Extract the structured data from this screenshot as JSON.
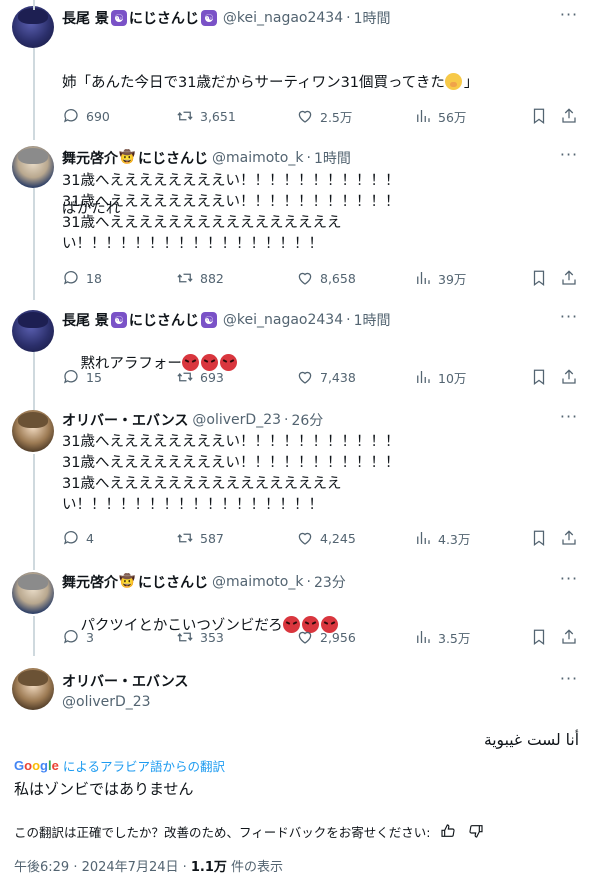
{
  "tweets": [
    {
      "name": "長尾 景",
      "badge_text": "にじさんじ",
      "handle": "@kei_nagao2434",
      "time": "1時間",
      "lines": [
        "姉「あんた今日で31歳だからサーティワン31個買ってきた",
        "」",
        "",
        "ばかたれ"
      ],
      "reply": "690",
      "retweet": "3,651",
      "like": "2.5万",
      "views": "56万"
    },
    {
      "name": "舞元啓介",
      "badge_text": "にじさんじ",
      "handle": "@maimoto_k",
      "time": "1時間",
      "text": "31歳へええええええええい！！！！！！！！！！！\n31歳へええええええええい！！！！！！！！！！！\n31歳へええええええええええええええええ\nい！！！！！！！！！！！！！！！！！",
      "reply": "18",
      "retweet": "882",
      "like": "8,658",
      "views": "39万"
    },
    {
      "name": "長尾 景",
      "badge_text": "にじさんじ",
      "handle": "@kei_nagao2434",
      "time": "1時間",
      "text": "黙れアラフォー",
      "reply": "15",
      "retweet": "693",
      "like": "7,438",
      "views": "10万"
    },
    {
      "name": "オリバー・エバンス",
      "handle": "@oliverD_23",
      "time": "26分",
      "text": "31歳へええええええええい！！！！！！！！！！！\n31歳へええええええええい！！！！！！！！！！！\n31歳へええええええええええええええええ\nい！！！！！！！！！！！！！！！！！",
      "reply": "4",
      "retweet": "587",
      "like": "4,245",
      "views": "4.3万"
    },
    {
      "name": "舞元啓介",
      "badge_text": "にじさんじ",
      "handle": "@maimoto_k",
      "time": "23分",
      "text": "パクツイとかこいつゾンビだろ",
      "reply": "3",
      "retweet": "353",
      "like": "2,956",
      "views": "3.5万"
    }
  ],
  "main": {
    "name": "オリバー・エバンス",
    "handle": "@oliverD_23",
    "original_text": "أنا لست غيبوية",
    "translated_by": "によるアラビア語からの翻訳",
    "translation": "私はゾンビではありません",
    "feedback": "この翻訳は正確でしたか？改善のため、フィードバックをお寄せください:",
    "timestamp": "午後6:29 · 2024年7月24日 · ",
    "views_count": "1.1万",
    "views_label": " 件の表示"
  },
  "google_letters": [
    "G",
    "o",
    "o",
    "g",
    "l",
    "e"
  ],
  "icons": {
    "reply": "reply-icon",
    "retweet": "retweet-icon",
    "like": "heart-icon",
    "views": "views-icon",
    "bookmark": "bookmark-icon",
    "share": "share-icon"
  },
  "colors": {
    "link": "#1d9bf0",
    "secondary": "#536471",
    "badge": "#7a52c7"
  }
}
